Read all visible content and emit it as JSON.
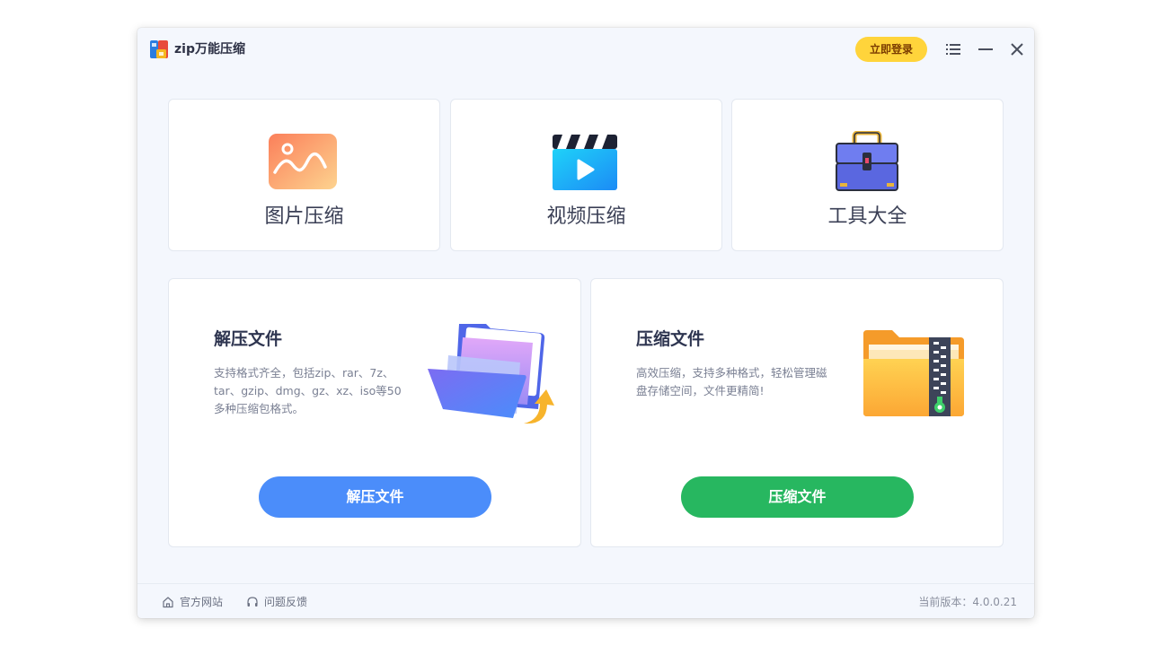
{
  "app": {
    "title": "zip万能压缩",
    "login_label": "立即登录"
  },
  "titlebar": {
    "icons": [
      "menu-icon",
      "minimize-icon",
      "close-icon"
    ]
  },
  "features": [
    {
      "label": "图片压缩",
      "icon": "image-icon"
    },
    {
      "label": "视频压缩",
      "icon": "video-clapper-icon"
    },
    {
      "label": "工具大全",
      "icon": "toolbox-icon"
    }
  ],
  "decompress": {
    "title": "解压文件",
    "description": "支持格式齐全，包括zip、rar、7z、tar、gzip、dmg、gz、xz、iso等50多种压缩包格式。",
    "button": "解压文件"
  },
  "compress": {
    "title": "压缩文件",
    "description": "高效压缩，支持多种格式，轻松管理磁盘存储空间，文件更精简!",
    "button": "压缩文件"
  },
  "footer": {
    "website": "官方网站",
    "feedback": "问题反馈",
    "version": "当前版本：4.0.0.21"
  },
  "colors": {
    "accent_yellow": "#ffd43b",
    "blue_button": "#4b8dfa",
    "green_button": "#27b760",
    "window_bg": "#f4f7fd"
  }
}
